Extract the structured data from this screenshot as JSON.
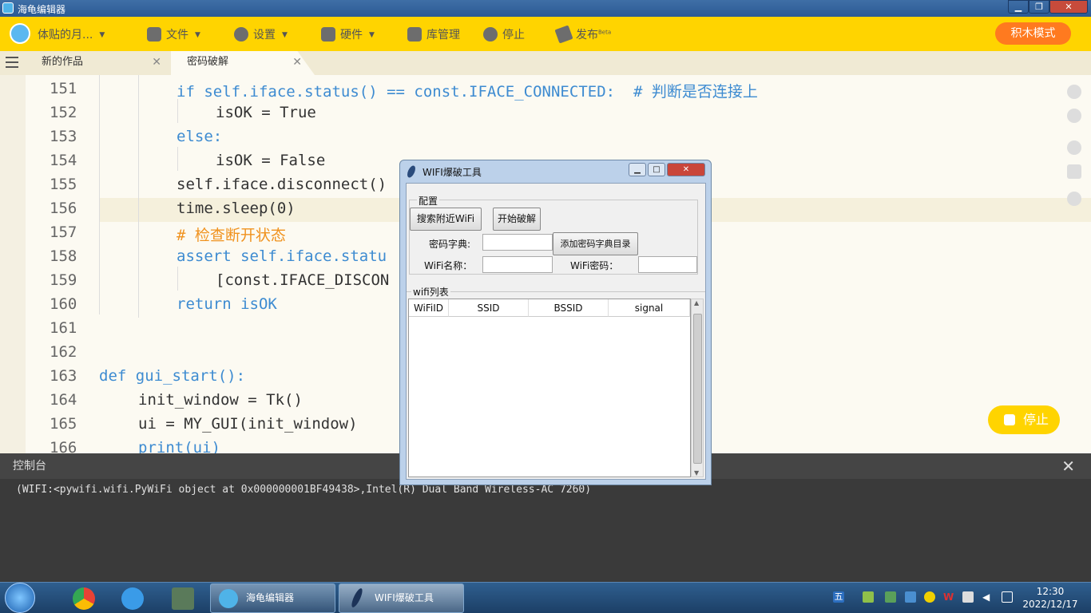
{
  "window": {
    "title": "海龟编辑器"
  },
  "toolbar": {
    "user": "体贴的月...",
    "file": "文件",
    "settings": "设置",
    "hardware": "硬件",
    "library": "库管理",
    "stop": "停止",
    "publish": "发布",
    "publish_badge": "Beta",
    "mode_button": "积木模式"
  },
  "tabs": [
    {
      "label": "新的作品"
    },
    {
      "label": "密码破解"
    }
  ],
  "code": {
    "lines": [
      {
        "no": "151",
        "text": "if self.iface.status() == const.IFACE_CONNECTED:  # 判断是否连接上"
      },
      {
        "no": "152",
        "text": "isOK = True"
      },
      {
        "no": "153",
        "text": "else:"
      },
      {
        "no": "154",
        "text": "isOK = False"
      },
      {
        "no": "155",
        "text": "self.iface.disconnect()"
      },
      {
        "no": "156",
        "text": "time.sleep(0)"
      },
      {
        "no": "157",
        "text": "# 检查断开状态"
      },
      {
        "no": "158",
        "text": "assert self.iface.statu"
      },
      {
        "no": "159",
        "text": "[const.IFACE_DISCON"
      },
      {
        "no": "160",
        "text": "return isOK"
      },
      {
        "no": "161",
        "text": ""
      },
      {
        "no": "162",
        "text": ""
      },
      {
        "no": "163",
        "text": "def gui_start():"
      },
      {
        "no": "164",
        "text": "init_window = Tk()"
      },
      {
        "no": "165",
        "text": "ui = MY_GUI(init_window)"
      },
      {
        "no": "166",
        "text": "print(ui)"
      }
    ]
  },
  "floating_stop": "停止",
  "console": {
    "title": "控制台",
    "output": "(WIFI:<pywifi.wifi.PyWiFi object at 0x000000001BF49438>,Intel(R) Dual Band Wireless-AC 7260)"
  },
  "wifi_dialog": {
    "title": "WIFI爆破工具",
    "config_group": "配置",
    "scan_button": "搜索附近WiFi",
    "crack_button": "开始破解",
    "dict_label": "密码字典:",
    "dict_value": "",
    "add_dict_button": "添加密码字典目录",
    "wifi_name_label": "WiFi名称：",
    "wifi_name_value": "",
    "wifi_pwd_label": "WiFi密码：",
    "wifi_pwd_value": "",
    "list_group": "wifi列表",
    "columns": [
      "WiFiID",
      "SSID",
      "BSSID",
      "signal"
    ]
  },
  "taskbar": {
    "tasks": [
      {
        "label": "海龟编辑器"
      },
      {
        "label": "WIFI爆破工具"
      }
    ],
    "time": "12:30",
    "date": "2022/12/17",
    "ime": "五"
  }
}
